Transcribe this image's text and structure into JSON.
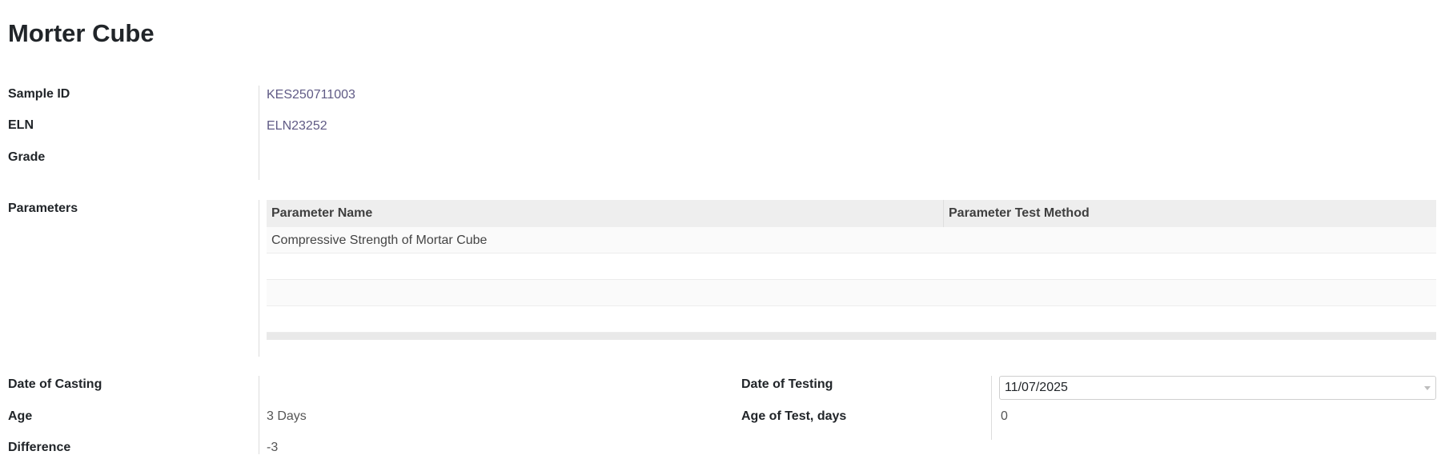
{
  "page": {
    "title": "Morter Cube"
  },
  "fields": {
    "sample_id": {
      "label": "Sample ID",
      "value": "KES250711003"
    },
    "eln": {
      "label": "ELN",
      "value": "ELN23252"
    },
    "grade": {
      "label": "Grade",
      "value": ""
    },
    "parameters": {
      "label": "Parameters"
    },
    "date_of_casting": {
      "label": "Date of Casting",
      "value": ""
    },
    "age": {
      "label": "Age",
      "value": "3 Days"
    },
    "difference": {
      "label": "Difference",
      "value": "-3"
    },
    "date_of_testing": {
      "label": "Date of Testing",
      "value": "11/07/2025"
    },
    "age_of_test": {
      "label": "Age of Test, days",
      "value": "0"
    }
  },
  "parameters_table": {
    "columns": [
      "Parameter Name",
      "Parameter Test Method"
    ],
    "rows": [
      {
        "name": "Compressive Strength of Mortar Cube",
        "method": ""
      },
      {
        "name": "",
        "method": ""
      },
      {
        "name": "",
        "method": ""
      },
      {
        "name": "",
        "method": ""
      }
    ]
  },
  "colors": {
    "link": "#5f5a85",
    "header_bg": "#eeeeee",
    "divider": "#dcdcdc"
  },
  "icons": {
    "date_dropdown": "chevron-down-icon"
  }
}
